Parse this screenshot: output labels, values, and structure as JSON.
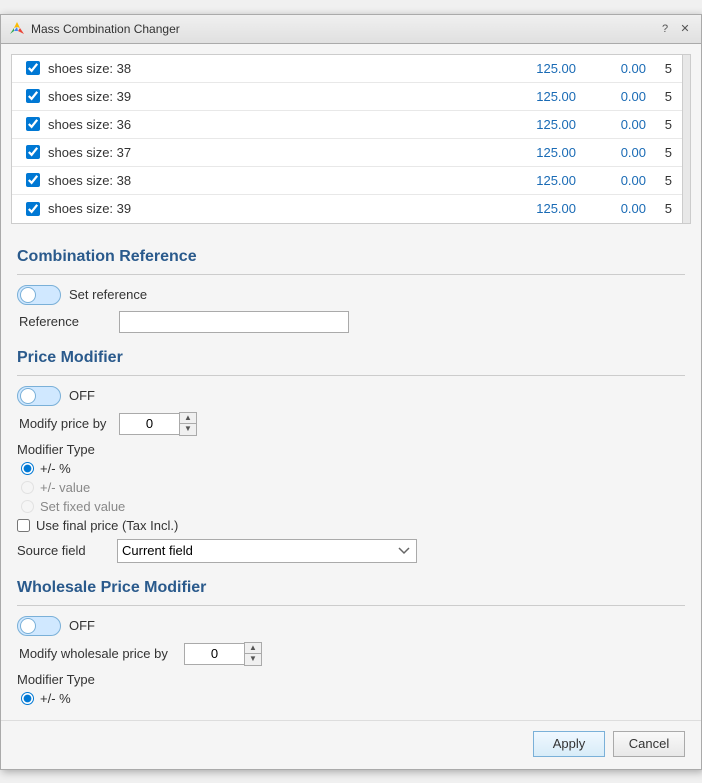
{
  "window": {
    "title": "Mass Combination Changer"
  },
  "table": {
    "rows": [
      {
        "checked": true,
        "label": "shoes size: 38",
        "val1": "125.00",
        "val2": "0.00",
        "val3": "5"
      },
      {
        "checked": true,
        "label": "shoes size: 39",
        "val1": "125.00",
        "val2": "0.00",
        "val3": "5"
      },
      {
        "checked": true,
        "label": "shoes size: 36",
        "val1": "125.00",
        "val2": "0.00",
        "val3": "5"
      },
      {
        "checked": true,
        "label": "shoes size: 37",
        "val1": "125.00",
        "val2": "0.00",
        "val3": "5"
      },
      {
        "checked": true,
        "label": "shoes size: 38",
        "val1": "125.00",
        "val2": "0.00",
        "val3": "5"
      },
      {
        "checked": true,
        "label": "shoes size: 39",
        "val1": "125.00",
        "val2": "0.00",
        "val3": "5"
      }
    ]
  },
  "combination_reference": {
    "title": "Combination Reference",
    "set_reference_label": "Set reference",
    "reference_label": "Reference"
  },
  "price_modifier": {
    "title": "Price Modifier",
    "toggle_state": "OFF",
    "modify_price_by_label": "Modify price by",
    "modify_price_by_value": "0",
    "modifier_type_label": "Modifier Type",
    "radio_options": [
      {
        "label": "+/- %",
        "checked": true,
        "disabled": false
      },
      {
        "label": "+/- value",
        "checked": false,
        "disabled": true
      },
      {
        "label": "Set fixed value",
        "checked": false,
        "disabled": true
      }
    ],
    "use_final_price_label": "Use final price (Tax Incl.)",
    "source_field_label": "Source field",
    "source_field_value": "Current field"
  },
  "wholesale_price_modifier": {
    "title": "Wholesale Price Modifier",
    "toggle_state": "OFF",
    "modify_price_by_label": "Modify wholesale price by",
    "modify_price_by_value": "0",
    "modifier_type_label": "Modifier Type",
    "radio_options": [
      {
        "label": "+/- %",
        "checked": true,
        "disabled": false
      }
    ]
  },
  "buttons": {
    "apply_label": "Apply",
    "cancel_label": "Cancel"
  }
}
